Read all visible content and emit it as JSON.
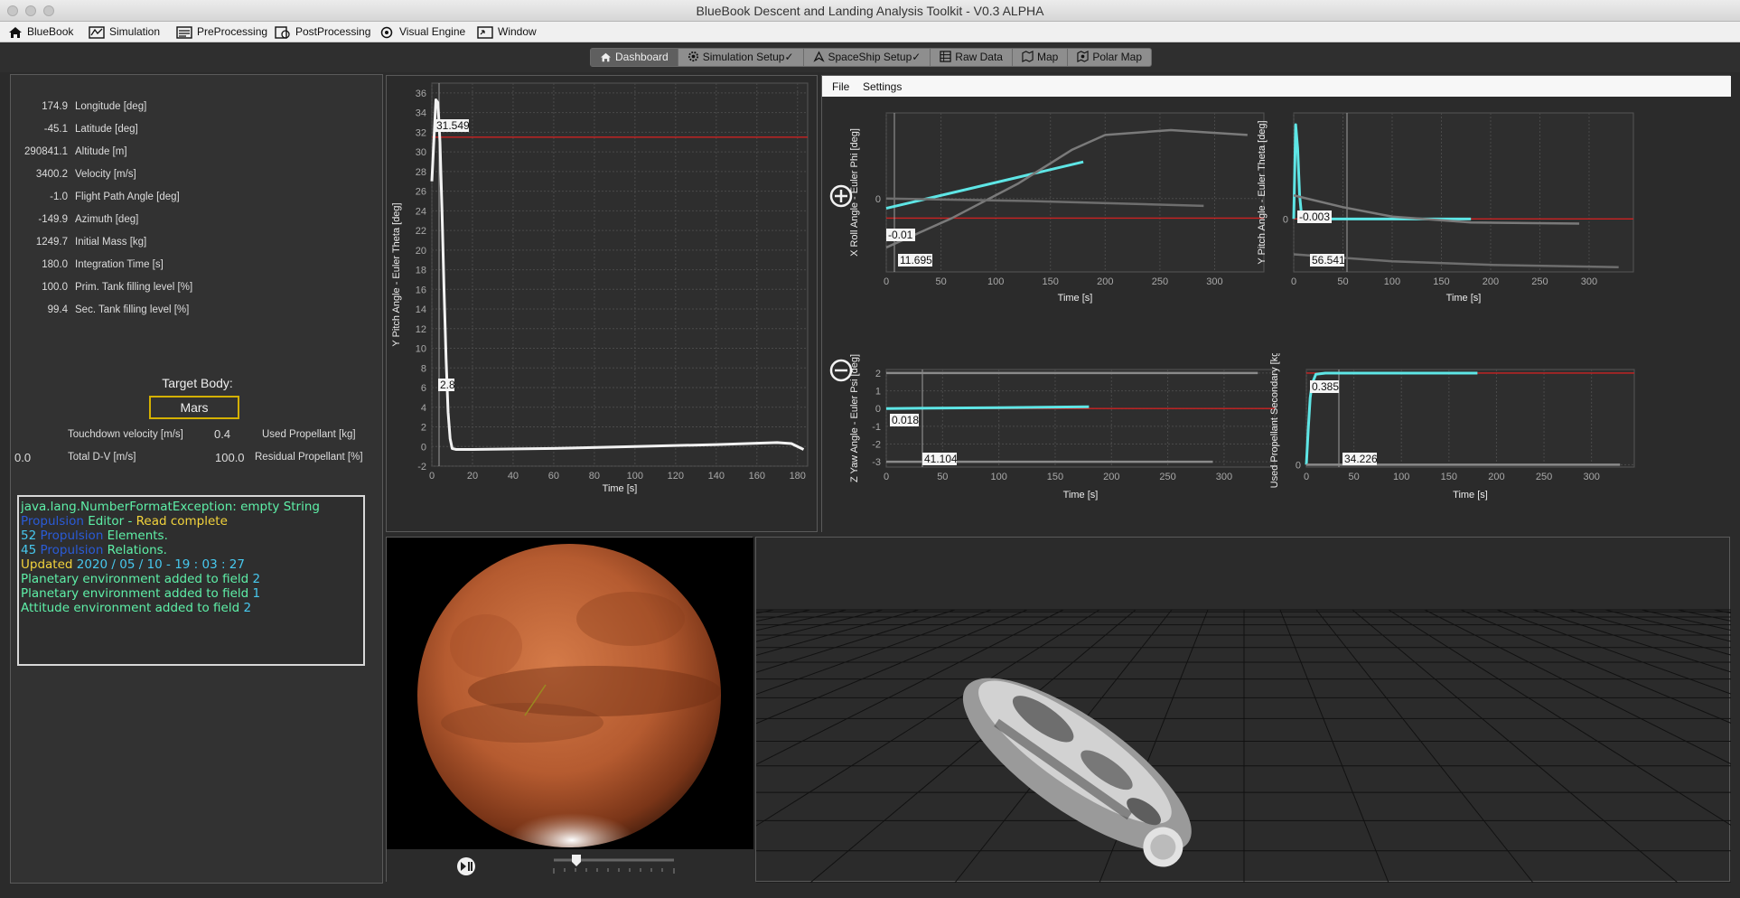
{
  "window": {
    "title": "BlueBook Descent and Landing Analysis Toolkit - V0.3 ALPHA"
  },
  "menu": [
    "BlueBook",
    "Simulation",
    "PreProcessing",
    "PostProcessing",
    "Visual Engine",
    "Window"
  ],
  "tabs": [
    "Dashboard",
    "Simulation Setup✓",
    "SpaceShip Setup✓",
    "Raw Data",
    "Map",
    "Polar Map"
  ],
  "active_tab": "Dashboard",
  "params": [
    {
      "value": "174.9",
      "label": "Longitude [deg]"
    },
    {
      "value": "-45.1",
      "label": "Latitude [deg]"
    },
    {
      "value": "290841.1",
      "label": "Altitude [m]"
    },
    {
      "value": "3400.2",
      "label": "Velocity [m/s]"
    },
    {
      "value": "-1.0",
      "label": "Flight Path Angle [deg]"
    },
    {
      "value": "-149.9",
      "label": "Azimuth [deg]"
    },
    {
      "value": "1249.7",
      "label": "Initial Mass [kg]"
    },
    {
      "value": "180.0",
      "label": "Integration Time [s]"
    },
    {
      "value": "100.0",
      "label": "Prim. Tank filling level [%]"
    },
    {
      "value": "99.4",
      "label": "Sec. Tank filling level [%]"
    }
  ],
  "target": {
    "title": "Target Body:",
    "value": "Mars"
  },
  "summary": {
    "touchdown_label": "Touchdown velocity [m/s]",
    "used_prop_value": "0.4",
    "used_prop_label": "Used Propellant [kg]",
    "dv_value": "0.0",
    "dv_label": "Total D-V [m/s]",
    "residual_value": "100.0",
    "residual_label": "Residual Propellant [%]"
  },
  "console": {
    "line1": "java.lang.NumberFormatException: empty String",
    "line2a": "Propulsion",
    "line2b": " Editor - ",
    "line2c": "Read complete",
    "line3a": "52",
    "line3b": " Propulsion",
    "line3c": " Elements.",
    "line4a": "45",
    "line4b": " Propulsion",
    "line4c": " Relations.",
    "line5a": "Updated",
    "line5b": " 2020 / 05 / 10 - 19 : 03 : 27",
    "line6a": "Planetary environment added to field ",
    "line6b": "2",
    "line7a": "Planetary environment added to field ",
    "line7b": "1",
    "line8a": "Attitude environment added to field ",
    "line8b": "2"
  },
  "chart_menu": {
    "file": "File",
    "settings": "Settings"
  },
  "colors": {
    "accent_cyan": "#5ee6e6",
    "limit_red": "#cc2222",
    "highlight_yellow": "#d4b000"
  },
  "icons": [
    "home-icon",
    "simulation-icon",
    "preprocessing-icon",
    "postprocessing-icon",
    "visual-engine-icon",
    "window-icon",
    "zoom-in-icon",
    "zoom-out-icon",
    "play-pause-icon"
  ],
  "chart_data": [
    {
      "type": "line",
      "ylabel": "Y Pitch Angle - Euler Theta [deg]",
      "xlabel": "Time [s]",
      "xlim": [
        0,
        185
      ],
      "ylim": [
        -2,
        37
      ],
      "xticks": [
        0,
        20,
        40,
        60,
        80,
        100,
        120,
        140,
        160,
        180
      ],
      "yticks": [
        -2,
        0,
        2,
        4,
        6,
        8,
        10,
        12,
        14,
        16,
        18,
        20,
        22,
        24,
        26,
        28,
        30,
        32,
        34,
        36
      ],
      "limit_value": 31.5,
      "annotations": [
        "31.549",
        "2.8"
      ],
      "series": [
        {
          "x": [
            0,
            2,
            3,
            4,
            5,
            6,
            7,
            8,
            9,
            10,
            12,
            20,
            60,
            100,
            140,
            170,
            177,
            183
          ],
          "y": [
            27,
            35.3,
            35,
            31,
            24,
            16,
            9,
            3.5,
            0.8,
            -0.2,
            -0.3,
            -0.3,
            -0.2,
            0,
            0.2,
            0.4,
            0.3,
            -0.3
          ]
        }
      ]
    },
    {
      "type": "line",
      "ylabel": "X Roll Angle - Euler Phi [deg]",
      "xlabel": "Time [s]",
      "xlim": [
        0,
        345
      ],
      "xticks": [
        0,
        50,
        100,
        150,
        200,
        250,
        300
      ],
      "yticks": [
        0
      ],
      "annotations": [
        "-0.01",
        "11.695"
      ],
      "series": [
        {
          "x": [
            0,
            180
          ],
          "y": [
            -0.4,
            1.5
          ]
        },
        {
          "x": [
            0,
            60,
            120,
            170,
            200,
            260,
            330
          ],
          "y": [
            -2,
            -0.8,
            0.6,
            2.0,
            2.6,
            2.8,
            2.6
          ]
        },
        {
          "x": [
            0,
            130,
            290
          ],
          "y": [
            0,
            -0.1,
            -0.3
          ]
        }
      ]
    },
    {
      "type": "line",
      "ylabel": "Y Pitch Angle - Euler Theta [deg]",
      "xlabel": "Time [s]",
      "xlim": [
        0,
        345
      ],
      "xticks": [
        0,
        50,
        100,
        150,
        200,
        250,
        300
      ],
      "yticks": [
        0
      ],
      "annotations": [
        "-0.003",
        "56.541"
      ],
      "series": [
        {
          "x": [
            0,
            2,
            4,
            6,
            8,
            12,
            40,
            180
          ],
          "y": [
            0,
            8,
            6,
            2,
            0.3,
            0,
            0,
            0
          ]
        },
        {
          "x": [
            0,
            50,
            100,
            180,
            290
          ],
          "y": [
            2,
            1,
            0.2,
            -0.3,
            -0.4
          ]
        },
        {
          "x": [
            0,
            100,
            200,
            330
          ],
          "y": [
            -3,
            -3.6,
            -3.9,
            -4.1
          ]
        }
      ]
    },
    {
      "type": "line",
      "ylabel": "Z Yaw Angle - Euler Psi [deg]",
      "xlabel": "Time [s]",
      "xlim": [
        0,
        345
      ],
      "ylim": [
        -3.3,
        2.2
      ],
      "xticks": [
        0,
        50,
        100,
        150,
        200,
        250,
        300
      ],
      "yticks": [
        -3,
        -2,
        -1,
        0,
        1,
        2
      ],
      "annotations": [
        "0.018",
        "41.104"
      ],
      "series": [
        {
          "x": [
            0,
            100,
            180
          ],
          "y": [
            0,
            0.05,
            0.1
          ]
        },
        {
          "x": [
            0,
            330
          ],
          "y": [
            2,
            2
          ]
        },
        {
          "x": [
            0,
            290
          ],
          "y": [
            -3,
            -3
          ]
        }
      ]
    },
    {
      "type": "line",
      "ylabel": "Used Propellant Secondary [kg]",
      "xlabel": "Time [s]",
      "xlim": [
        0,
        345
      ],
      "xticks": [
        0,
        50,
        100,
        150,
        200,
        250,
        300
      ],
      "yticks": [
        0
      ],
      "annotations": [
        "0.385",
        "34.226"
      ],
      "series": [
        {
          "x": [
            0,
            2,
            4,
            6,
            10,
            20,
            180
          ],
          "y": [
            0,
            0.15,
            0.28,
            0.34,
            0.38,
            0.385,
            0.385
          ]
        },
        {
          "x": [
            0,
            330
          ],
          "y": [
            0,
            0
          ]
        }
      ]
    }
  ]
}
